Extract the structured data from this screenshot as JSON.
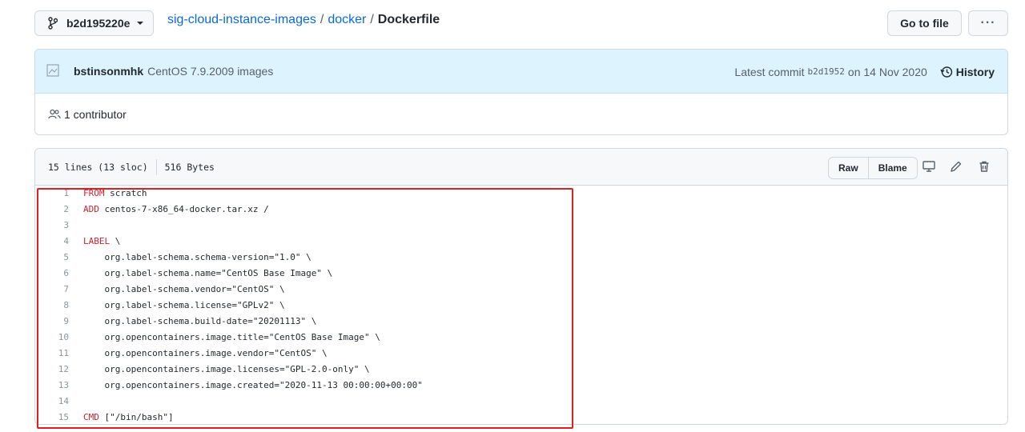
{
  "branch": {
    "name": "b2d195220e",
    "icon": "git-branch-icon"
  },
  "breadcrumb": {
    "repo": "sig-cloud-instance-images",
    "sep1": "/",
    "dir": "docker",
    "sep2": "/",
    "file": "Dockerfile"
  },
  "toolbar": {
    "goto_label": "Go to file",
    "more_label": "···"
  },
  "commit": {
    "author": "bstinsonmhk",
    "message": "CentOS 7.9.2009 images",
    "latest_label": "Latest commit",
    "sha": "b2d1952",
    "date": "on 14 Nov 2020",
    "history_label": "History"
  },
  "contributors": {
    "text": "1 contributor"
  },
  "file": {
    "lines_info": "15 lines (13 sloc)",
    "size": "516 Bytes",
    "raw_label": "Raw",
    "blame_label": "Blame"
  },
  "code_lines": [
    {
      "n": "1",
      "kw": "FROM",
      "rest": " scratch"
    },
    {
      "n": "2",
      "kw": "ADD",
      "rest": " centos-7-x86_64-docker.tar.xz /"
    },
    {
      "n": "3",
      "kw": "",
      "rest": ""
    },
    {
      "n": "4",
      "kw": "LABEL",
      "rest": " \\"
    },
    {
      "n": "5",
      "kw": "",
      "rest": "    org.label-schema.schema-version=\"1.0\" \\"
    },
    {
      "n": "6",
      "kw": "",
      "rest": "    org.label-schema.name=\"CentOS Base Image\" \\"
    },
    {
      "n": "7",
      "kw": "",
      "rest": "    org.label-schema.vendor=\"CentOS\" \\"
    },
    {
      "n": "8",
      "kw": "",
      "rest": "    org.label-schema.license=\"GPLv2\" \\"
    },
    {
      "n": "9",
      "kw": "",
      "rest": "    org.label-schema.build-date=\"20201113\" \\"
    },
    {
      "n": "10",
      "kw": "",
      "rest": "    org.opencontainers.image.title=\"CentOS Base Image\" \\"
    },
    {
      "n": "11",
      "kw": "",
      "rest": "    org.opencontainers.image.vendor=\"CentOS\" \\"
    },
    {
      "n": "12",
      "kw": "",
      "rest": "    org.opencontainers.image.licenses=\"GPL-2.0-only\" \\"
    },
    {
      "n": "13",
      "kw": "",
      "rest": "    org.opencontainers.image.created=\"2020-11-13 00:00:00+00:00\""
    },
    {
      "n": "14",
      "kw": "",
      "rest": ""
    },
    {
      "n": "15",
      "kw": "CMD",
      "rest": " [\"/bin/bash\"]"
    }
  ],
  "colors": {
    "link": "#0969da",
    "keyword": "#cf222e",
    "highlight_border": "#e0201f",
    "commit_bg": "#ddf4ff"
  }
}
